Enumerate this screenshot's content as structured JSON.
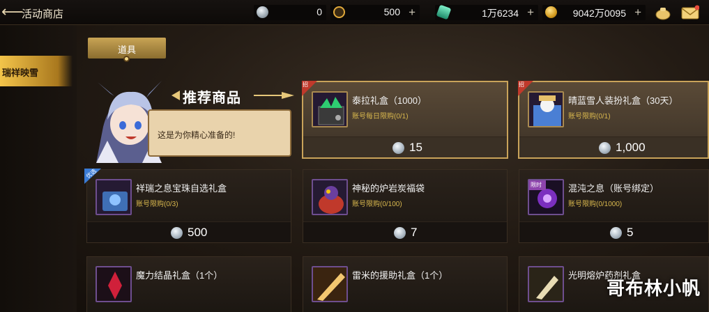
{
  "header": {
    "title": "活动商店",
    "currencies": [
      {
        "icon": "silver-coin-icon",
        "value": "0"
      },
      {
        "icon": "gold-c-icon",
        "value": "500"
      },
      {
        "icon": "green-crystal-icon",
        "value": "1万6234"
      },
      {
        "icon": "gold-coin-icon",
        "value": "9042万0095"
      }
    ],
    "plus_label": "+"
  },
  "sidebar": {
    "active_item": "瑞祥映雪"
  },
  "tabs": [
    {
      "label": "道具"
    }
  ],
  "recommend": {
    "title": "推荐商品",
    "bubble_text": "这是为你精心准备的!"
  },
  "items": [
    {
      "name": "泰拉礼盒（1000）",
      "limit": "账号每日限购(0/1)",
      "price": "15",
      "tag": "招",
      "featured": true
    },
    {
      "name": "晴蓝雪人装扮礼盒（30天）",
      "limit": "账号限购(0/1)",
      "price": "1,000",
      "tag": "招",
      "featured": true
    },
    {
      "name": "祥瑞之息宝珠自选礼盒",
      "limit": "账号限购(0/3)",
      "price": "500",
      "tag": "优选",
      "featured": false
    },
    {
      "name": "神秘的炉岩炭福袋",
      "limit": "账号限购(0/100)",
      "price": "7",
      "tag": "",
      "featured": false
    },
    {
      "name": "混沌之息（账号绑定）",
      "limit": "账号限购(0/1000)",
      "price": "5",
      "tag": "限时",
      "featured": false
    },
    {
      "name": "魔力结晶礼盒（1个）",
      "limit": "",
      "price": "",
      "tag": "",
      "featured": false
    },
    {
      "name": "雷米的援助礼盒（1个）",
      "limit": "",
      "price": "",
      "tag": "",
      "featured": false
    },
    {
      "name": "光明熔炉药剂礼盒",
      "limit": "",
      "price": "",
      "tag": "",
      "featured": false
    }
  ],
  "watermark": "哥布林小帆",
  "colors": {
    "accent_gold": "#c9a35a",
    "limit_text": "#d9b84e",
    "tab_active": "#f3c44a"
  }
}
